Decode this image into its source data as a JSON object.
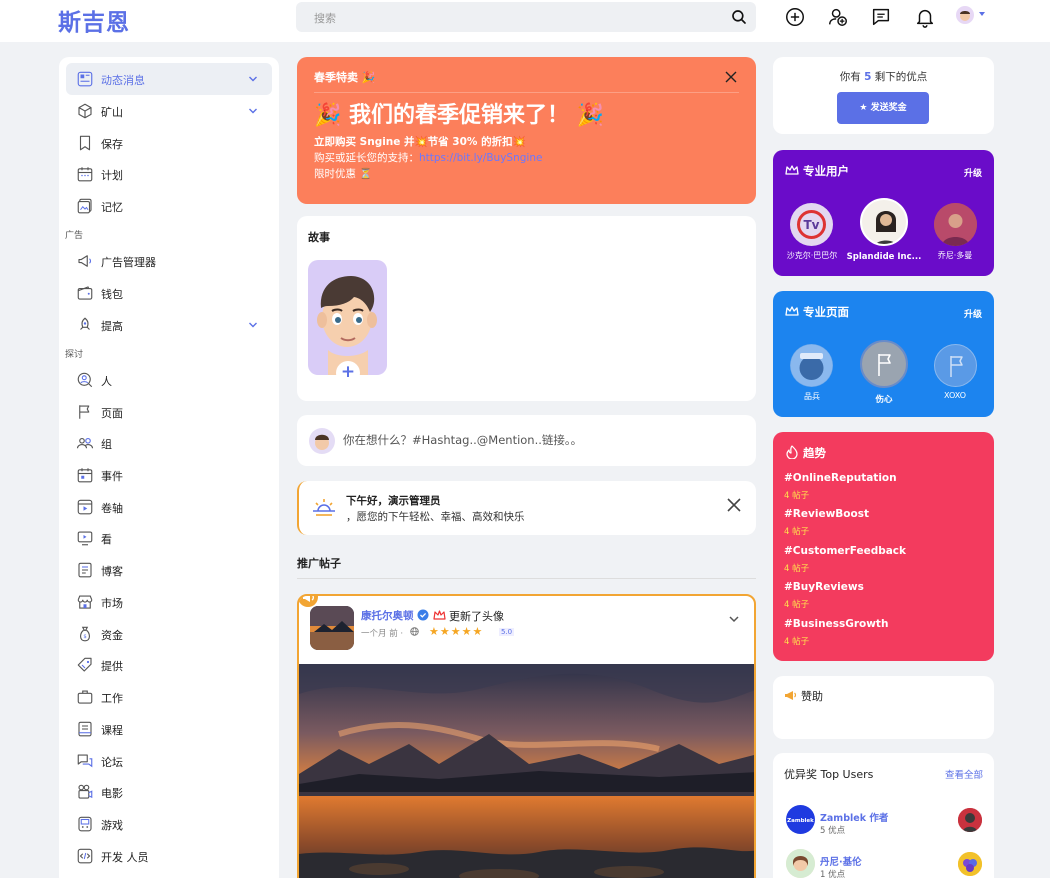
{
  "header": {
    "logo": "斯吉恩",
    "search_placeholder": "搜索",
    "icons": [
      "search-icon",
      "add-circle-icon",
      "add-friend-icon",
      "messages-icon",
      "bell-icon",
      "avatar"
    ]
  },
  "sidebar": {
    "items_main": [
      {
        "label": "动态消息",
        "icon": "feed-icon",
        "chevron": true,
        "active": true
      },
      {
        "label": "矿山",
        "icon": "cube-icon",
        "chevron": true
      },
      {
        "label": "保存",
        "icon": "bookmark-icon"
      },
      {
        "label": "计划",
        "icon": "calendar-icon"
      },
      {
        "label": "记忆",
        "icon": "memories-icon"
      }
    ],
    "section_ads": "广告",
    "items_ads": [
      {
        "label": "广告管理器",
        "icon": "megaphone-icon"
      },
      {
        "label": "钱包",
        "icon": "wallet-icon"
      },
      {
        "label": "提高",
        "icon": "boost-icon",
        "chevron": true
      }
    ],
    "section_explore": "探讨",
    "items_explore": [
      {
        "label": "人",
        "icon": "people-icon"
      },
      {
        "label": "页面",
        "icon": "flag-icon"
      },
      {
        "label": "组",
        "icon": "groups-icon"
      },
      {
        "label": "事件",
        "icon": "event-icon"
      },
      {
        "label": "卷轴",
        "icon": "reels-icon"
      },
      {
        "label": "看",
        "icon": "watch-icon"
      },
      {
        "label": "博客",
        "icon": "blog-icon"
      },
      {
        "label": "市场",
        "icon": "market-icon"
      },
      {
        "label": "资金",
        "icon": "funding-icon"
      },
      {
        "label": "提供",
        "icon": "offers-icon"
      },
      {
        "label": "工作",
        "icon": "jobs-icon"
      },
      {
        "label": "课程",
        "icon": "courses-icon"
      },
      {
        "label": "论坛",
        "icon": "forums-icon"
      },
      {
        "label": "电影",
        "icon": "movies-icon"
      },
      {
        "label": "游戏",
        "icon": "games-icon"
      },
      {
        "label": "开发 人员",
        "icon": "developers-icon"
      }
    ]
  },
  "promo": {
    "title": "春季特卖 🎉",
    "headline": "🎉 我们的春季促销来了！ 🎉",
    "line1": "立即购买 Sngine 并💥节省 30% 的折扣💥",
    "line2_prefix": "购买或延长您的支持：",
    "line2_link": "https://bit.ly/BuySngine",
    "line3": "限时优惠 ⏳"
  },
  "stories": {
    "title": "故事"
  },
  "composer": {
    "placeholder": "你在想什么？#Hashtag..@Mention..链接。。"
  },
  "greeting": {
    "title": "下午好，演示管理员",
    "subtitle": "，愿您的下午轻松、幸福、高效和快乐"
  },
  "promoted": {
    "title": "推广帖子",
    "post": {
      "author": "康托尔奥顿",
      "action": "更新了头像",
      "time": "一个月 前",
      "stars": "★★★★★",
      "rating": "5.0"
    }
  },
  "points": {
    "text_prefix": "你有",
    "count": "5",
    "text_suffix": "剩下的优点",
    "button": "发送奖金"
  },
  "pro_users": {
    "title": "专业用户",
    "upgrade": "升级",
    "users": [
      {
        "name": "沙克尔·巴巴尔"
      },
      {
        "name": "Splandide Inc..."
      },
      {
        "name": "乔尼·多曼"
      }
    ]
  },
  "pro_pages": {
    "title": "专业页面",
    "upgrade": "升级",
    "pages": [
      {
        "name": "品兵"
      },
      {
        "name": "伤心"
      },
      {
        "name": "XOXO"
      }
    ]
  },
  "trends": {
    "title": "趋势",
    "items": [
      {
        "tag": "#OnlineReputation",
        "count": "4 帖子"
      },
      {
        "tag": "#ReviewBoost",
        "count": "4 帖子"
      },
      {
        "tag": "#CustomerFeedback",
        "count": "4 帖子"
      },
      {
        "tag": "#BuyReviews",
        "count": "4 帖子"
      },
      {
        "tag": "#BusinessGrowth",
        "count": "4 帖子"
      }
    ]
  },
  "sponsor": {
    "title": "赞助"
  },
  "top_users": {
    "title": "优异奖 Top Users",
    "see_all": "查看全部",
    "users": [
      {
        "name": "Zamblek 作者",
        "points": "5 优点"
      },
      {
        "name": "丹尼·基伦",
        "points": "1 优点"
      }
    ]
  },
  "colors": {
    "accent": "#5b70e6",
    "promo": "#fc7f5b",
    "pro_users": "#6a0cc9",
    "pro_pages": "#1c84ef",
    "trends": "#f33b5e",
    "highlight": "#f2a533"
  }
}
